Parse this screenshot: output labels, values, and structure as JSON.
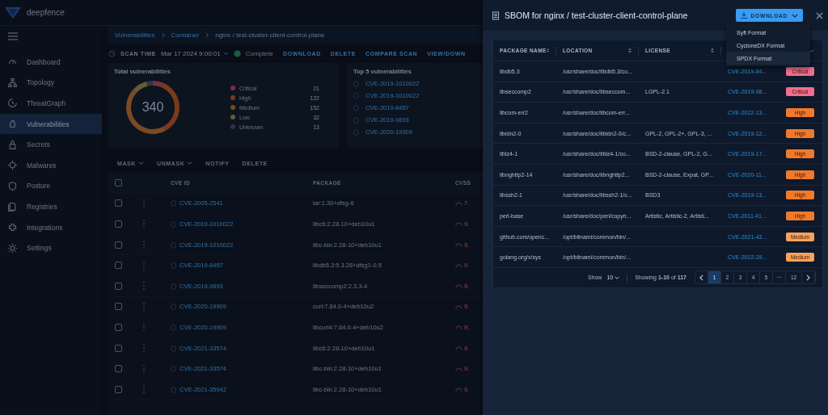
{
  "app": {
    "logo_text": "deepfence"
  },
  "sidebar": {
    "items": [
      {
        "label": "Dashboard",
        "selected": false
      },
      {
        "label": "Topology",
        "selected": false
      },
      {
        "label": "ThreatGraph",
        "selected": false
      },
      {
        "label": "Vulnerabilities",
        "selected": true
      },
      {
        "label": "Secrets",
        "selected": false
      },
      {
        "label": "Malwares",
        "selected": false
      },
      {
        "label": "Posture",
        "selected": false
      },
      {
        "label": "Registries",
        "selected": false
      },
      {
        "label": "Integrations",
        "selected": false
      },
      {
        "label": "Settings",
        "selected": false
      }
    ]
  },
  "breadcrumb": [
    {
      "label": "Vulnerabilities",
      "kind": "link"
    },
    {
      "label": "Container",
      "kind": "link"
    },
    {
      "label": "nginx / test-cluster-client-control-plane",
      "kind": "current"
    }
  ],
  "scan_bar": {
    "label": "SCAN TIME",
    "time": "Mar 17 2024 9:00:01",
    "status": "Complete",
    "actions": [
      "DOWNLOAD",
      "DELETE",
      "COMPARE SCAN",
      "VIEW/DOWN"
    ]
  },
  "total_card": {
    "title": "Total vulnerabilities",
    "total": "340",
    "legend": [
      {
        "count": "21",
        "color": "#7a2f45"
      },
      {
        "count": "122",
        "color": "#7a3a1c"
      },
      {
        "count": "152",
        "color": "#7a4a26"
      },
      {
        "count": "32",
        "color": "#6a5a30"
      },
      {
        "count": "13",
        "color": "#2c3544"
      }
    ],
    "chart_data": {
      "type": "donut",
      "categories": [
        "Critical",
        "High",
        "Medium",
        "Low",
        "Unknown"
      ],
      "values": [
        6.2,
        35.9,
        44.7,
        9.4,
        3.8
      ]
    }
  },
  "top5_card": {
    "title": "Top 5 vulnerabilities",
    "items": [
      "CVE-2019-1010022",
      "CVE-2019-1010022",
      "CVE-2019-8457",
      "CVE-2019-9893",
      "CVE-2020-19909"
    ]
  },
  "bulk_actions": [
    {
      "label": "MASK",
      "has_menu": true
    },
    {
      "label": "UNMASK",
      "has_menu": true
    },
    {
      "label": "NOTIFY",
      "has_menu": false
    },
    {
      "label": "DELETE",
      "has_menu": false
    }
  ],
  "vuln_table": {
    "columns": [
      "CVE ID",
      "PACKAGE",
      "CVSS"
    ],
    "header_checked": false,
    "rows": [
      {
        "cve": "CVE-2005-2541",
        "package": "tar:1.30+dfsg-6",
        "cvss": "7.",
        "checked": false
      },
      {
        "cve": "CVE-2019-1010022",
        "package": "libc6:2.28-10+deb10u1",
        "cvss": "9.",
        "checked": false
      },
      {
        "cve": "CVE-2019-1010022",
        "package": "libc-bin:2.28-10+deb10u1",
        "cvss": "9.",
        "checked": false
      },
      {
        "cve": "CVE-2019-8457",
        "package": "libdb5.3:5.3.28+dfsg1-0.5",
        "cvss": "9.",
        "checked": false
      },
      {
        "cve": "CVE-2019-9893",
        "package": "libseccomp2:2.3.3-4",
        "cvss": "9.",
        "checked": false
      },
      {
        "cve": "CVE-2020-19909",
        "package": "curl:7.64.0-4+deb10u2",
        "cvss": "9.",
        "checked": false
      },
      {
        "cve": "CVE-2020-19909",
        "package": "libcurl4:7.64.0-4+deb10u2",
        "cvss": "9.",
        "checked": false
      },
      {
        "cve": "CVE-2021-33574",
        "package": "libc6:2.28-10+deb10u1",
        "cvss": "9.",
        "checked": false
      },
      {
        "cve": "CVE-2021-33574",
        "package": "libc-bin:2.28-10+deb10u1",
        "cvss": "9.",
        "checked": false
      },
      {
        "cve": "CVE-2021-35942",
        "package": "libc-bin:2.28-10+deb10u1",
        "cvss": "9.",
        "checked": false
      }
    ]
  },
  "drawer": {
    "title": "SBOM for nginx / test-cluster-client-control-plane",
    "download_button": "DOWNLOAD",
    "download_menu": [
      {
        "label": "Syft Format",
        "highlighted": false
      },
      {
        "label": "CycloneDX Format",
        "highlighted": false
      },
      {
        "label": "SPDX Format",
        "highlighted": true
      }
    ],
    "sbom_table": {
      "columns": [
        "PACKAGE NAME",
        "LOCATION",
        "LICENSE"
      ],
      "rows": [
        {
          "package": "libdb5.3",
          "location": "/usr/share/doc/libdb5.3/co...",
          "license": "",
          "cve": "CVE-2019-84...",
          "severity": "Critical",
          "color": "#f06d8c"
        },
        {
          "package": "libseccomp2",
          "location": "/usr/share/doc/libseccom...",
          "license": "LGPL-2.1",
          "cve": "CVE-2019-98...",
          "severity": "Critical",
          "color": "#f06d8c"
        },
        {
          "package": "libcom-err2",
          "location": "/usr/share/doc/libcom-err...",
          "license": "",
          "cve": "CVE-2022-13...",
          "severity": "High",
          "color": "#f07a2c"
        },
        {
          "package": "libidn2-0",
          "location": "/usr/share/doc/libidn2-0/c...",
          "license": "GPL-2, GPL-2+, GPL-3, ...",
          "cve": "CVE-2019-12...",
          "severity": "High",
          "color": "#f07a2c"
        },
        {
          "package": "liblz4-1",
          "location": "/usr/share/doc/liblz4-1/co...",
          "license": "BSD-2-clause, GPL-2, G...",
          "cve": "CVE-2019-17...",
          "severity": "High",
          "color": "#f07a2c"
        },
        {
          "package": "libnghttp2-14",
          "location": "/usr/share/doc/libnghttp2...",
          "license": "BSD-2-clause, Expat, GP...",
          "cve": "CVE-2020-11...",
          "severity": "High",
          "color": "#f07a2c"
        },
        {
          "package": "libssh2-1",
          "location": "/usr/share/doc/libssh2-1/c...",
          "license": "BSD3",
          "cve": "CVE-2019-13...",
          "severity": "High",
          "color": "#f07a2c"
        },
        {
          "package": "perl-base",
          "location": "/usr/share/doc/perl/copyri...",
          "license": "Artistic, Artistic-2, Artisti...",
          "cve": "CVE-2011-41...",
          "severity": "High",
          "color": "#f07a2c"
        },
        {
          "package": "github.com/openc...",
          "location": "/opt/bitnami/common/bin/...",
          "license": "",
          "cve": "CVE-2021-43...",
          "severity": "Medium",
          "color": "#f7a25a"
        },
        {
          "package": "golang.org/x/sys",
          "location": "/opt/bitnami/common/bin/...",
          "license": "",
          "cve": "CVE-2022-29...",
          "severity": "Medium",
          "color": "#f7a25a"
        }
      ]
    },
    "pagination": {
      "show_label": "Show",
      "page_size": "10",
      "showing": "Showing **1-10** of **117**",
      "pages": [
        {
          "label": "1",
          "selected": true
        },
        {
          "label": "2",
          "selected": false
        },
        {
          "label": "3",
          "selected": false
        },
        {
          "label": "4",
          "selected": false
        },
        {
          "label": "5",
          "selected": false
        },
        {
          "label": "···",
          "selected": false
        },
        {
          "label": "12",
          "selected": false
        }
      ]
    }
  }
}
